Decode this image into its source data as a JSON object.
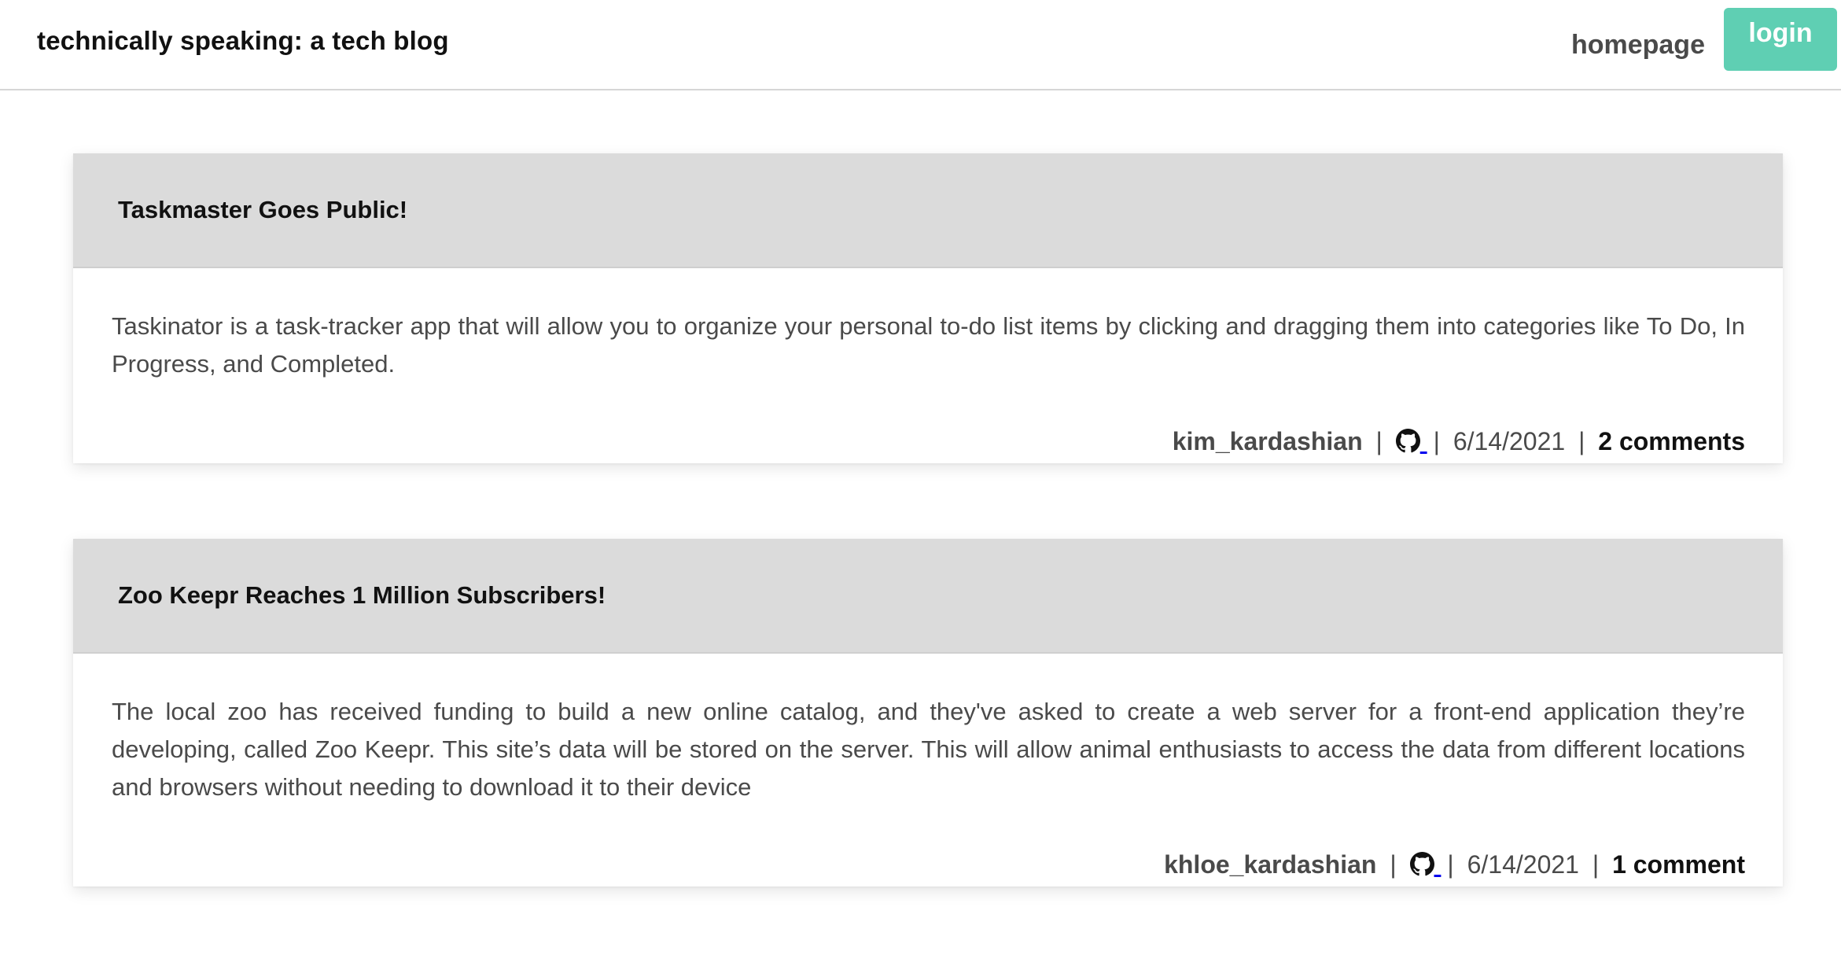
{
  "header": {
    "site_title": "technically speaking: a tech blog",
    "nav": {
      "homepage_label": "homepage",
      "login_label": "login"
    }
  },
  "posts": [
    {
      "title": "Taskmaster Goes Public!",
      "body": "Taskinator is a task-tracker app that will allow you to organize your personal to-do list items by clicking and dragging them into categories like To Do, In Progress, and Completed.",
      "author": "kim_kardashian",
      "icon": "github-icon",
      "date": "6/14/2021",
      "comments_label": "2 comments"
    },
    {
      "title": "Zoo Keepr Reaches 1 Million Subscribers!",
      "body": "The local zoo has received funding to build a new online catalog, and they've asked to create a web server for a front-end application they’re developing, called Zoo Keepr. This site’s data will be stored on the server. This will allow animal enthusiasts to access the data from different locations and browsers without needing to download it to their device",
      "author": "khloe_kardashian",
      "icon": "github-icon",
      "date": "6/14/2021",
      "comments_label": "1 comment"
    }
  ],
  "meta_separator": "|",
  "colors": {
    "accent": "#5fcfb3",
    "card_header": "#dbdbdb",
    "text": "#4a4a4a",
    "heading": "#111111"
  }
}
